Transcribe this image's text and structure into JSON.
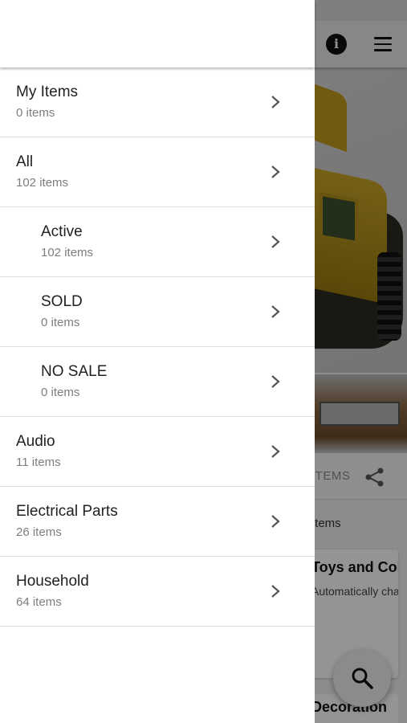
{
  "drawer": {
    "items": [
      {
        "title": "My Items",
        "count": "0 items"
      },
      {
        "title": "All",
        "count": "102 items"
      },
      {
        "title": "Active",
        "count": "102 items"
      },
      {
        "title": "SOLD",
        "count": "0 items"
      },
      {
        "title": "NO SALE",
        "count": "0 items"
      },
      {
        "title": "Audio",
        "count": "11 items"
      },
      {
        "title": "Electrical Parts",
        "count": "26 items"
      },
      {
        "title": "Household",
        "count": "64 items"
      }
    ]
  },
  "background": {
    "info_icon": "i",
    "actions_label": "ITEMS",
    "section_label": "Items",
    "card_title": "Toys and Collectibles",
    "card_subtitle": "Automatically changes",
    "card2_title": "Decoration"
  },
  "icons": {
    "info": "info-icon",
    "menu": "menu-icon",
    "share": "share-icon",
    "search": "search-icon",
    "chevron": "chevron-right-icon"
  }
}
